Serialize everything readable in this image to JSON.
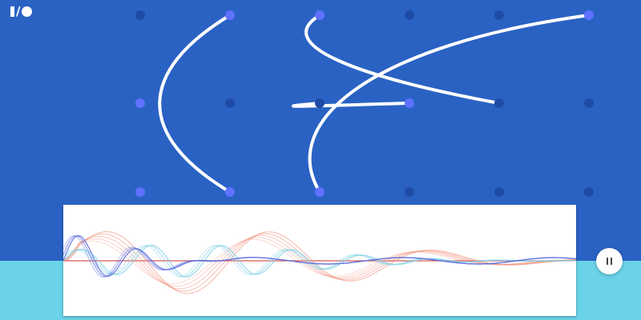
{
  "logo": {
    "name": "I/O",
    "glyph_slash": "/"
  },
  "colors": {
    "sky": "#2a62c4",
    "ground": "#6ad3e8",
    "node_active": "#5f71ff",
    "node_idle": "#1e4ba6",
    "string": "#ffffff",
    "wave_red": "#f08a74",
    "wave_blue": "#5b6dde",
    "wave_cyan": "#7fd0e6",
    "wave_baseline": "#d95757"
  },
  "board": {
    "columns": 6,
    "rows": 3,
    "active_nodes": [
      "0-1",
      "0-2",
      "1-0",
      "1-2",
      "2-0",
      "2-2",
      "3-1",
      "5-0"
    ],
    "strings": [
      {
        "from": "1-0",
        "to": "1-2"
      },
      {
        "from": "2-0",
        "to": "4-1"
      },
      {
        "from": "2-1",
        "to": "3-1"
      },
      {
        "from": "2-2",
        "to": "5-0"
      }
    ]
  },
  "controls": {
    "pause_icon": "pause-icon",
    "state": "playing"
  }
}
